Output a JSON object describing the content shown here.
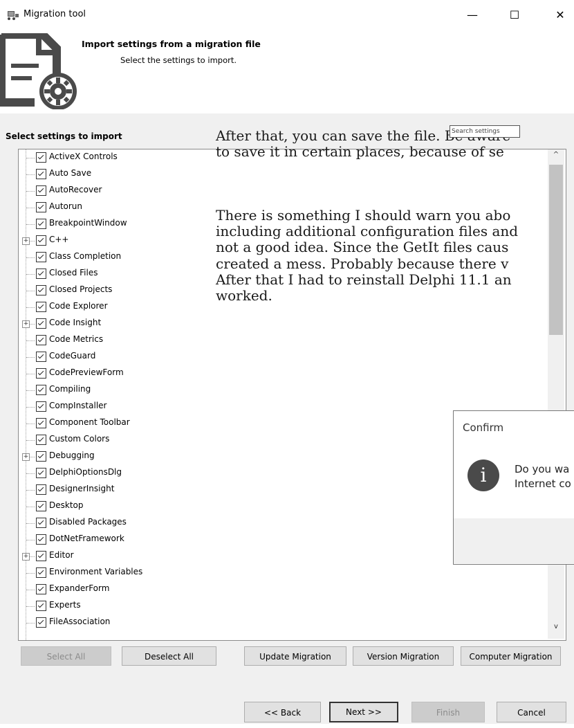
{
  "window": {
    "title": "Migration tool",
    "minimize_glyph": "—",
    "maximize_glyph": "☐",
    "close_glyph": "✕"
  },
  "header": {
    "title": "Import settings from a migration file",
    "subtitle": "Select the settings to import.",
    "icon": "document-gear-icon"
  },
  "overlay": {
    "paragraph1": "After that, you can save the file. Be aware\nto save it in certain places, because of se",
    "paragraph2": "There is something I should warn you abo\nincluding additional configuration files and\nnot a good idea. Since the GetIt files caus\ncreated a mess. Probably because there v\nAfter that I had to reinstall Delphi 11.1 an\nworked.",
    "search_placeholder": "Search settings"
  },
  "tree": {
    "label": "Select settings to import",
    "items": [
      {
        "label": "ActiveX Controls",
        "checked": true,
        "expandable": false
      },
      {
        "label": "Auto Save",
        "checked": true,
        "expandable": false
      },
      {
        "label": "AutoRecover",
        "checked": true,
        "expandable": false
      },
      {
        "label": "Autorun",
        "checked": true,
        "expandable": false
      },
      {
        "label": "BreakpointWindow",
        "checked": true,
        "expandable": false
      },
      {
        "label": "C++",
        "checked": true,
        "expandable": true
      },
      {
        "label": "Class Completion",
        "checked": true,
        "expandable": false
      },
      {
        "label": "Closed Files",
        "checked": true,
        "expandable": false
      },
      {
        "label": "Closed Projects",
        "checked": true,
        "expandable": false
      },
      {
        "label": "Code Explorer",
        "checked": true,
        "expandable": false
      },
      {
        "label": "Code Insight",
        "checked": true,
        "expandable": true
      },
      {
        "label": "Code Metrics",
        "checked": true,
        "expandable": false
      },
      {
        "label": "CodeGuard",
        "checked": true,
        "expandable": false
      },
      {
        "label": "CodePreviewForm",
        "checked": true,
        "expandable": false
      },
      {
        "label": "Compiling",
        "checked": true,
        "expandable": false
      },
      {
        "label": "CompInstaller",
        "checked": true,
        "expandable": false
      },
      {
        "label": "Component Toolbar",
        "checked": true,
        "expandable": false
      },
      {
        "label": "Custom Colors",
        "checked": true,
        "expandable": false
      },
      {
        "label": "Debugging",
        "checked": true,
        "expandable": true
      },
      {
        "label": "DelphiOptionsDlg",
        "checked": true,
        "expandable": false
      },
      {
        "label": "DesignerInsight",
        "checked": true,
        "expandable": false
      },
      {
        "label": "Desktop",
        "checked": true,
        "expandable": false
      },
      {
        "label": "Disabled Packages",
        "checked": true,
        "expandable": false
      },
      {
        "label": "DotNetFramework",
        "checked": true,
        "expandable": false
      },
      {
        "label": "Editor",
        "checked": true,
        "expandable": true
      },
      {
        "label": "Environment Variables",
        "checked": true,
        "expandable": false
      },
      {
        "label": "ExpanderForm",
        "checked": true,
        "expandable": false
      },
      {
        "label": "Experts",
        "checked": true,
        "expandable": false
      },
      {
        "label": "FileAssociation",
        "checked": true,
        "expandable": false
      }
    ]
  },
  "scroll": {
    "up_glyph": "^",
    "down_glyph": "v"
  },
  "dialog": {
    "title": "Confirm",
    "icon_glyph": "i",
    "line1": "Do you wa",
    "line2": "Internet co"
  },
  "buttons": {
    "select_all": "Select All",
    "deselect_all": "Deselect All",
    "update_migration": "Update Migration",
    "version_migration": "Version Migration",
    "computer_migration": "Computer Migration",
    "back": "<< Back",
    "next": "Next >>",
    "finish": "Finish",
    "cancel": "Cancel"
  }
}
